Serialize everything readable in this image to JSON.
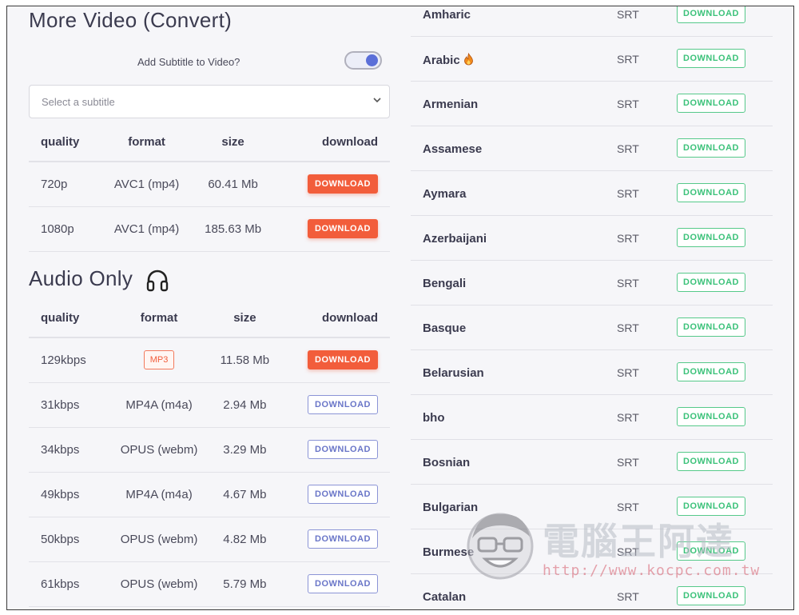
{
  "video_section": {
    "title": "More Video (Convert)",
    "subtitle_toggle_label": "Add Subtitle to Video?",
    "subtitle_toggle_on": true,
    "subtitle_select_placeholder": "Select a subtitle",
    "headers": [
      "quality",
      "format",
      "size",
      "download"
    ],
    "rows": [
      {
        "quality": "720p",
        "format": "AVC1 (mp4)",
        "size": "60.41 Mb",
        "button": "DOWNLOAD"
      },
      {
        "quality": "1080p",
        "format": "AVC1 (mp4)",
        "size": "185.63 Mb",
        "button": "DOWNLOAD"
      }
    ]
  },
  "audio_section": {
    "title": "Audio Only",
    "icon": "headphones-icon",
    "headers": [
      "quality",
      "format",
      "size",
      "download"
    ],
    "rows": [
      {
        "quality": "129kbps",
        "format": "MP3",
        "size": "11.58 Mb",
        "button": "DOWNLOAD"
      },
      {
        "quality": "31kbps",
        "format": "MP4A (m4a)",
        "size": "2.94 Mb",
        "button": "DOWNLOAD"
      },
      {
        "quality": "34kbps",
        "format": "OPUS (webm)",
        "size": "3.29 Mb",
        "button": "DOWNLOAD"
      },
      {
        "quality": "49kbps",
        "format": "MP4A (m4a)",
        "size": "4.67 Mb",
        "button": "DOWNLOAD"
      },
      {
        "quality": "50kbps",
        "format": "OPUS (webm)",
        "size": "4.82 Mb",
        "button": "DOWNLOAD"
      },
      {
        "quality": "61kbps",
        "format": "OPUS (webm)",
        "size": "5.79 Mb",
        "button": "DOWNLOAD"
      }
    ]
  },
  "subtitles": {
    "rows": [
      {
        "language": "Amharic",
        "format": "SRT",
        "button": "DOWNLOAD"
      },
      {
        "language": "Arabic",
        "format": "SRT",
        "button": "DOWNLOAD",
        "icon": "flame-icon"
      },
      {
        "language": "Armenian",
        "format": "SRT",
        "button": "DOWNLOAD"
      },
      {
        "language": "Assamese",
        "format": "SRT",
        "button": "DOWNLOAD"
      },
      {
        "language": "Aymara",
        "format": "SRT",
        "button": "DOWNLOAD"
      },
      {
        "language": "Azerbaijani",
        "format": "SRT",
        "button": "DOWNLOAD"
      },
      {
        "language": "Bengali",
        "format": "SRT",
        "button": "DOWNLOAD"
      },
      {
        "language": "Basque",
        "format": "SRT",
        "button": "DOWNLOAD"
      },
      {
        "language": "Belarusian",
        "format": "SRT",
        "button": "DOWNLOAD"
      },
      {
        "language": "bho",
        "format": "SRT",
        "button": "DOWNLOAD"
      },
      {
        "language": "Bosnian",
        "format": "SRT",
        "button": "DOWNLOAD"
      },
      {
        "language": "Bulgarian",
        "format": "SRT",
        "button": "DOWNLOAD"
      },
      {
        "language": "Burmese",
        "format": "SRT",
        "button": "DOWNLOAD"
      },
      {
        "language": "Catalan",
        "format": "SRT",
        "button": "DOWNLOAD"
      }
    ]
  },
  "watermark": {
    "text": "電腦王阿達",
    "url": "http://www.kocpc.com.tw"
  },
  "colors": {
    "accent_red": "#f25d3b",
    "accent_blue": "#6a76c8",
    "accent_green": "#3cc27a",
    "toggle_knob": "#5b6fd8"
  }
}
